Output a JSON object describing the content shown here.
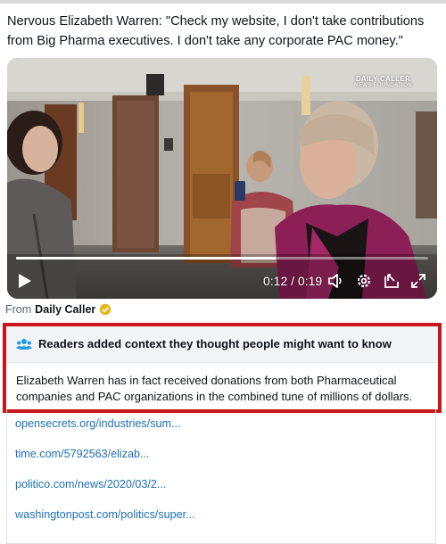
{
  "post": {
    "text": "Nervous Elizabeth Warren: \"Check my website, I don't take contributions from Big Pharma executives. I don't take any corporate PAC money.\""
  },
  "video": {
    "watermark_line1": "DAILY CALLER",
    "watermark_line2": "NEWS FOUNDATION",
    "current_time": "0:12",
    "duration": "0:19",
    "progress": 0.63,
    "icons": [
      "play-icon",
      "volume-icon",
      "settings-icon",
      "pip-icon",
      "fullscreen-icon"
    ]
  },
  "source": {
    "prefix": "From",
    "name": "Daily Caller",
    "badge": "verified-gold-badge"
  },
  "community_note": {
    "header": "Readers added context they thought people might want to know",
    "body": "Elizabeth Warren has in fact received donations from both Pharmaceutical companies and PAC organizations in the combined tune of millions of dollars.",
    "highlight_color": "#c8161d"
  },
  "links": [
    "opensecrets.org/industries/sum...",
    "time.com/5792563/elizab...",
    "politico.com/news/2020/03/2...",
    "washingtonpost.com/politics/super..."
  ]
}
